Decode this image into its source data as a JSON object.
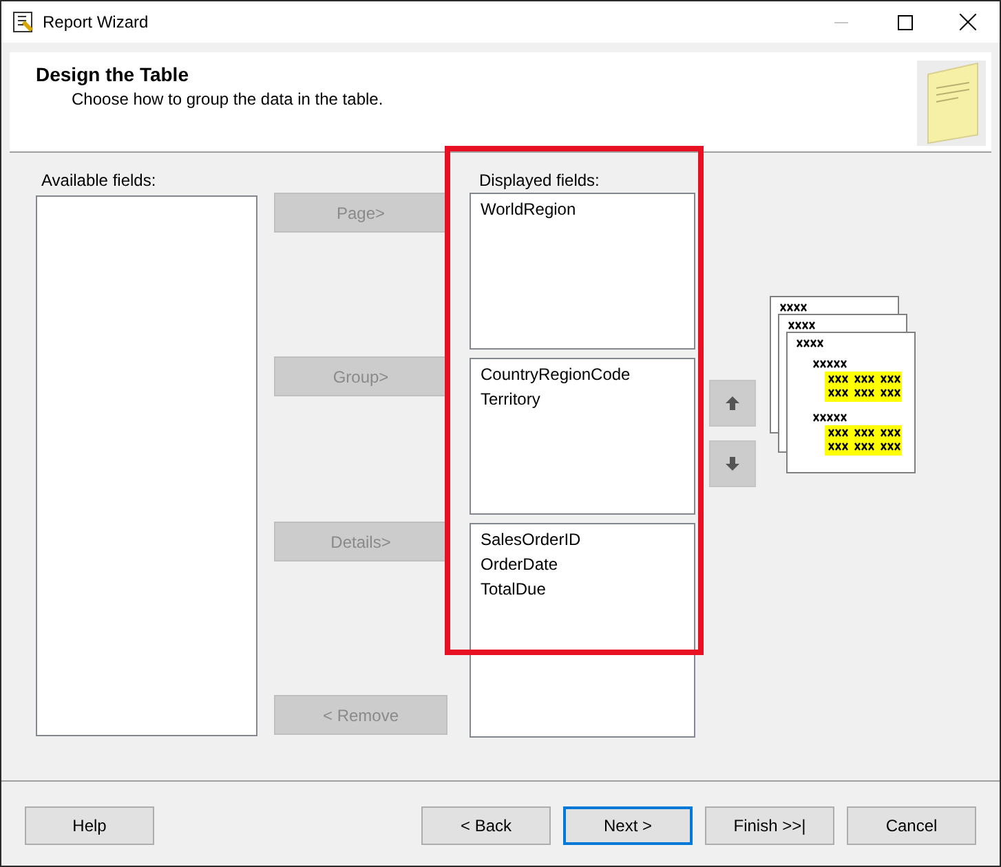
{
  "window": {
    "title": "Report Wizard",
    "controls": [
      {
        "kind": "minimize",
        "disabled": true
      },
      {
        "kind": "maximize",
        "disabled": false
      },
      {
        "kind": "close",
        "disabled": false
      }
    ]
  },
  "header": {
    "title": "Design the Table",
    "subtitle": "Choose how to group the data in the table."
  },
  "available_fields": {
    "label": "Available fields:"
  },
  "move_buttons": [
    {
      "label": "Page>",
      "disabled": true
    },
    {
      "label": "Group>",
      "disabled": true
    },
    {
      "label": "Details>",
      "disabled": true
    },
    {
      "label": "< Remove",
      "disabled": true
    }
  ],
  "displayed_fields": {
    "label": "Displayed fields:",
    "highlighted": true,
    "groups": [
      {
        "kind": "page",
        "items": [
          "WorldRegion"
        ]
      },
      {
        "kind": "group",
        "items": [
          "CountryRegionCode",
          "Territory"
        ]
      },
      {
        "kind": "details",
        "items": [
          "SalesOrderID",
          "OrderDate",
          "TotalDue"
        ]
      }
    ]
  },
  "order_buttons": [
    {
      "kind": "up",
      "disabled": false
    },
    {
      "kind": "down",
      "disabled": false
    }
  ],
  "footer_buttons": [
    {
      "label": "Help",
      "default": false
    },
    {
      "label": "< Back",
      "default": false
    },
    {
      "label": "Next >",
      "default": true
    },
    {
      "label": "Finish >>|",
      "default": false
    },
    {
      "label": "Cancel",
      "default": false
    }
  ]
}
